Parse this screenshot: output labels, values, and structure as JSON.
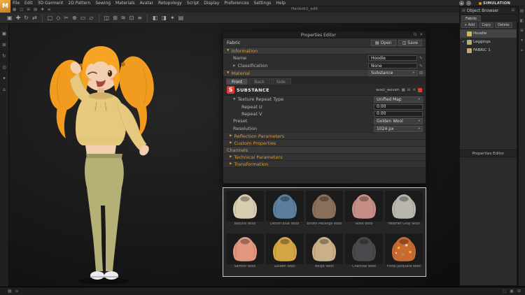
{
  "app": {
    "logo": "M",
    "menu": [
      "File",
      "Edit",
      "3D Garment",
      "2D Pattern",
      "Sewing",
      "Materials",
      "Avatar",
      "Retopology",
      "Script",
      "Display",
      "Preferences",
      "Settings",
      "Help"
    ],
    "view_title": "Hanbok1_edit",
    "simulation_label": "SIMULATION"
  },
  "icons": {
    "dropdown": "▾",
    "pencil": "✎",
    "check": "✓",
    "close": "✕",
    "pin": "⊡",
    "folder_open": "▤",
    "save": "◫",
    "tri_open": "▼",
    "tri_closed": "▶",
    "panel": "▤",
    "collapse": "⊟",
    "list": "≡",
    "grid": "▦",
    "user": "◉",
    "bell": "◔",
    "plus": "⊞"
  },
  "quickbar": [
    "▦",
    "◫",
    "⊞",
    "▤",
    "✚",
    "≡"
  ],
  "toolbar": {
    "g1": [
      "▣",
      "✚",
      "↻",
      "⇄"
    ],
    "g2": [
      "□",
      "◇",
      "✂",
      "⊕",
      "▭",
      "▱"
    ],
    "g3": [
      "◫",
      "⊞",
      "≋",
      "⊡",
      "≡"
    ],
    "g4": [
      "◧",
      "◨",
      "✦",
      "▤"
    ]
  },
  "lefttools": [
    "▣",
    "⊞",
    "↻",
    "◎",
    "✦",
    "⌂"
  ],
  "edge": [
    "▤",
    "◧",
    "⊞",
    "✦",
    "⌂"
  ],
  "properties": {
    "title": "Properties Editor",
    "object_type": "Fabric",
    "open_label": "Open",
    "save_label": "Save",
    "info_header": "Information",
    "name_label": "Name",
    "name_value": "Hoodie",
    "classification_label": "Classification",
    "classification_value": "None",
    "material_header": "Material",
    "material_type": "Substance",
    "tabs": [
      "Front",
      "Back",
      "Side"
    ],
    "substance_brand": "SUBSTANCE",
    "substance_file": "wool_woven",
    "texture_repeat_label": "Texture Repeat Type",
    "texture_repeat_value": "Unified Map",
    "repeat_u_label": "Repeat U",
    "repeat_u_value": "0.00",
    "repeat_v_label": "Repeat V",
    "repeat_v_value": "0.00",
    "preset_label": "Preset",
    "preset_value": "Golden Wool",
    "resolution_label": "Resolution",
    "resolution_value": "1024 px",
    "reflection_header": "Reflection Parameters",
    "custom_header": "Custom Properties",
    "channels_header": "Channels",
    "technical_header": "Technical Parameters",
    "transform_header": "Transformation"
  },
  "gallery": {
    "items": [
      {
        "name": "Natural Wool",
        "color": "#d8cdb0"
      },
      {
        "name": "Denim Blue Wool",
        "color": "#5b7f9c"
      },
      {
        "name": "Brown Melange Wool",
        "color": "#8a6f5a"
      },
      {
        "name": "Rose Wool",
        "color": "#c58f86"
      },
      {
        "name": "Heather Gray Wool",
        "color": "#b9b6ae"
      },
      {
        "name": "Salmon Wool",
        "color": "#e2967e"
      },
      {
        "name": "Golden Wool",
        "color": "#d2a545"
      },
      {
        "name": "Beige Wool",
        "color": "#c9b089"
      },
      {
        "name": "Charcoal Wool",
        "color": "#4a4a4e"
      },
      {
        "name": "Floral Jacquard Wool",
        "color": "#c96a32"
      }
    ]
  },
  "object_browser": {
    "title": "Object Browser",
    "tab": "Fabric",
    "add_label": "+ Add",
    "copy_label": "Copy",
    "delete_label": "Delete",
    "items": [
      {
        "name": "Hoodie",
        "swatch": "#d9b84a"
      },
      {
        "name": "Leggings",
        "swatch": "#b4b06e"
      },
      {
        "name": "FABRIC 1",
        "swatch": "#c8a66b"
      }
    ],
    "docked_label": "Properties Editor"
  },
  "colors": {
    "accent_orange": "#d79b3f",
    "substance_red": "#e23a2e",
    "simulation_dot": "#e88a2e"
  },
  "status": {
    "left_icons": [
      "▦",
      "≡"
    ],
    "right_icons": [
      "▢",
      "▣",
      "⊞"
    ]
  }
}
